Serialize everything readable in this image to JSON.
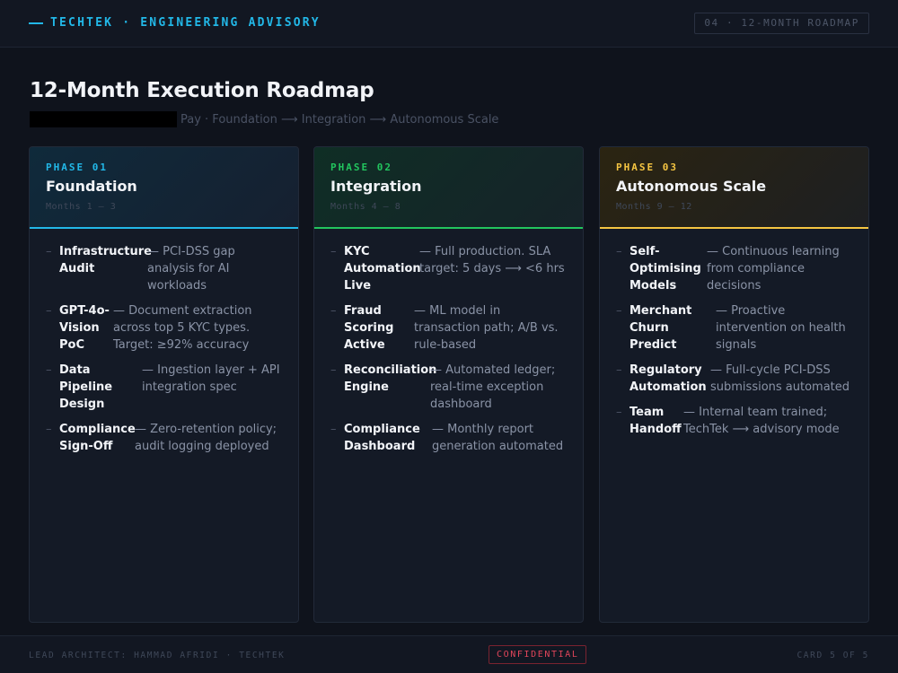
{
  "header": {
    "brand": "TECHTEK · ENGINEERING ADVISORY",
    "slide_tag": "04 · 12-MONTH ROADMAP"
  },
  "title": "12-Month Execution Roadmap",
  "subtitle": "Pay · Foundation ⟶ Integration ⟶ Autonomous Scale",
  "colors": {
    "phase1_accent": "#22b8e8",
    "phase2_accent": "#22c55e",
    "phase3_accent": "#f5c542",
    "confidential": "#e0455a"
  },
  "phases": [
    {
      "label": "PHASE 01",
      "title": "Foundation",
      "months": "Months 1 – 3",
      "items": [
        {
          "name": "Infrastructure Audit",
          "desc": "— PCI-DSS gap analysis for AI workloads"
        },
        {
          "name": "GPT-4o-Vision PoC",
          "desc": "— Document extraction across top 5 KYC types. Target: ≥92% accuracy"
        },
        {
          "name": "Data Pipeline Design",
          "desc": "— Ingestion layer + API integration spec"
        },
        {
          "name": "Compliance Sign-Off",
          "desc": "— Zero-retention policy; audit logging deployed"
        }
      ]
    },
    {
      "label": "PHASE 02",
      "title": "Integration",
      "months": "Months 4 – 8",
      "items": [
        {
          "name": "KYC Automation Live",
          "desc": "— Full production. SLA target: 5 days ⟶ <6 hrs"
        },
        {
          "name": "Fraud Scoring Active",
          "desc": "— ML model in transaction path; A/B vs. rule-based"
        },
        {
          "name": "Reconciliation Engine",
          "desc": "— Automated ledger; real-time exception dashboard"
        },
        {
          "name": "Compliance Dashboard",
          "desc": "— Monthly report generation automated"
        }
      ]
    },
    {
      "label": "PHASE 03",
      "title": "Autonomous Scale",
      "months": "Months 9 – 12",
      "items": [
        {
          "name": "Self-Optimising Models",
          "desc": "— Continuous learning from compliance decisions"
        },
        {
          "name": "Merchant Churn Predict",
          "desc": "— Proactive intervention on health signals"
        },
        {
          "name": "Regulatory Automation",
          "desc": "— Full-cycle PCI-DSS submissions automated"
        },
        {
          "name": "Team Handoff",
          "desc": "— Internal team trained; TechTek ⟶ advisory mode"
        }
      ]
    }
  ],
  "footer": {
    "lead": "LEAD ARCHITECT: HAMMAD AFRIDI · TECHTEK",
    "confidential": "CONFIDENTIAL",
    "card_count": "CARD 5 OF 5"
  }
}
